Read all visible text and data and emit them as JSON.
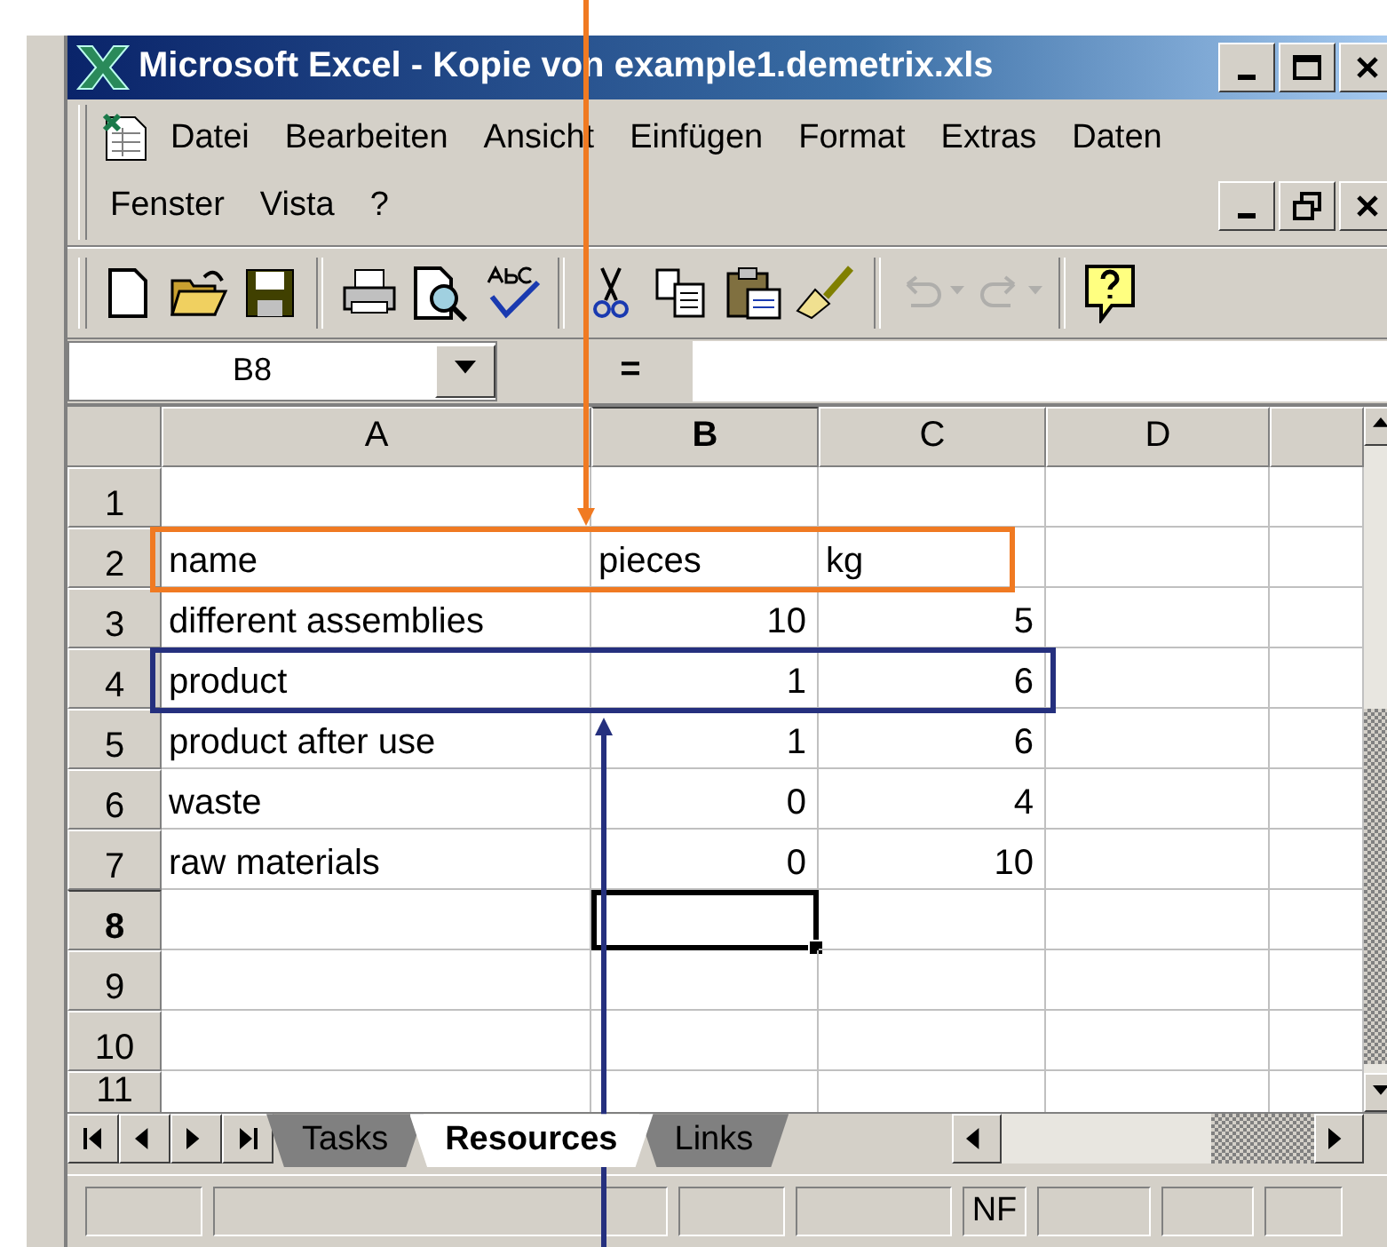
{
  "window": {
    "title": "Microsoft Excel - Kopie von example1.demetrix.xls"
  },
  "menu_rows": [
    [
      {
        "label": "Datei"
      },
      {
        "label": "Bearbeiten"
      },
      {
        "label": "Ansicht"
      },
      {
        "label": "Einfügen"
      },
      {
        "label": "Format"
      },
      {
        "label": "Extras"
      },
      {
        "label": "Daten"
      }
    ],
    [
      {
        "label": "Fenster"
      },
      {
        "label": "Vista"
      },
      {
        "label": "?"
      }
    ]
  ],
  "toolbar": {
    "undo": {
      "disabled": true
    },
    "redo": {
      "disabled": true
    }
  },
  "formula_bar": {
    "name_box": "B8",
    "equals": "="
  },
  "columns": [
    {
      "label": "A",
      "selected": false
    },
    {
      "label": "B",
      "selected": true
    },
    {
      "label": "C",
      "selected": false
    },
    {
      "label": "D",
      "selected": false
    }
  ],
  "rows": [
    {
      "label": "1",
      "selected": false,
      "kind": "data",
      "cells": []
    },
    {
      "label": "2",
      "selected": false,
      "kind": "text",
      "cells": [
        "name",
        "pieces",
        "kg"
      ],
      "annotation": {
        "kind": "arrow_from_top",
        "color": "#f07a22"
      }
    },
    {
      "label": "3",
      "selected": false,
      "kind": "data",
      "cells": [
        "different assemblies",
        "10",
        "5"
      ]
    },
    {
      "label": "4",
      "selected": false,
      "kind": "data",
      "cells": [
        "product",
        "1",
        "6"
      ],
      "annotation": {
        "kind": "arrow_from_bottom",
        "color": "#25307e"
      }
    },
    {
      "label": "5",
      "selected": false,
      "kind": "data",
      "cells": [
        "product after use",
        "1",
        "6"
      ]
    },
    {
      "label": "6",
      "selected": false,
      "kind": "data",
      "cells": [
        "waste",
        "0",
        "4"
      ]
    },
    {
      "label": "7",
      "selected": false,
      "kind": "data",
      "cells": [
        "raw materials",
        "0",
        "10"
      ]
    },
    {
      "label": "8",
      "selected": true,
      "kind": "data",
      "cells": []
    },
    {
      "label": "9",
      "selected": false,
      "kind": "data",
      "cells": []
    },
    {
      "label": "10",
      "selected": false,
      "kind": "data",
      "cells": []
    },
    {
      "label": "11",
      "selected": false,
      "kind": "data",
      "cells": []
    }
  ],
  "sheet_tabs": [
    {
      "label": "Tasks",
      "selected": false
    },
    {
      "label": "Resources",
      "selected": true
    },
    {
      "label": "Links",
      "selected": false
    }
  ],
  "status_bar": {
    "indicator": "NF"
  }
}
